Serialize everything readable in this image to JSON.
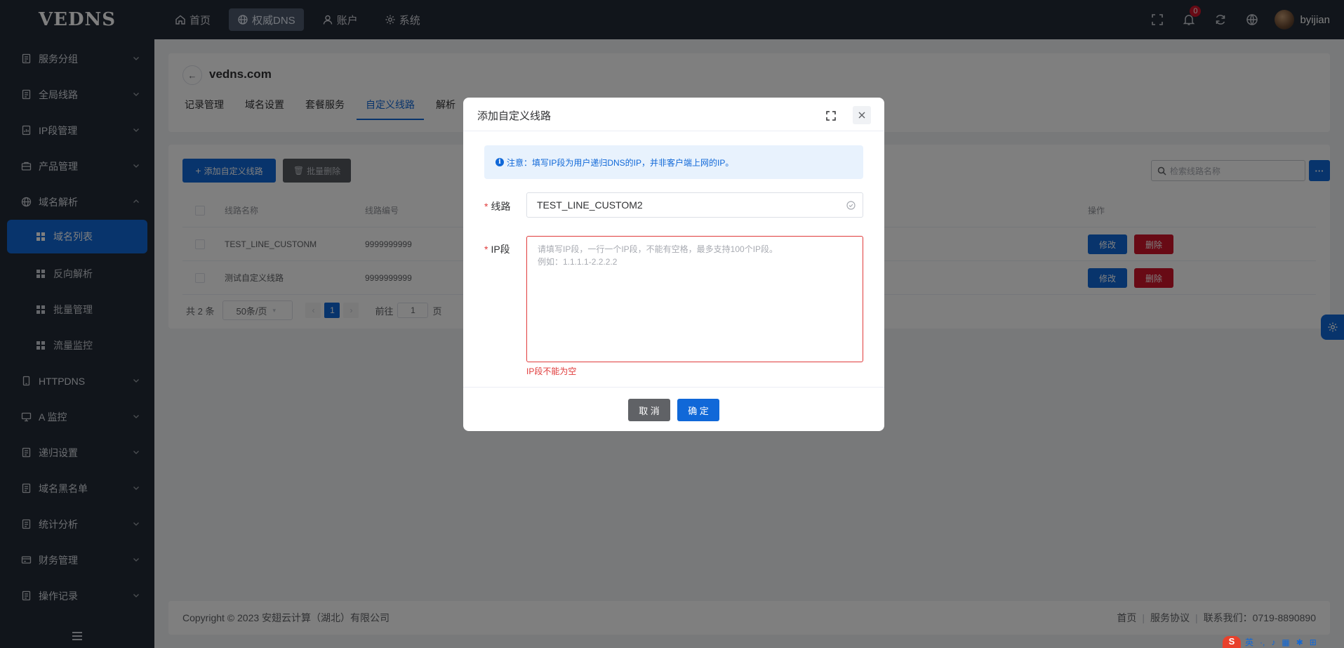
{
  "app": {
    "logo": "VEDNS"
  },
  "topnav": [
    {
      "label": "首页",
      "icon": "home-icon"
    },
    {
      "label": "权威DNS",
      "icon": "globe-icon"
    },
    {
      "label": "账户",
      "icon": "user-icon"
    },
    {
      "label": "系统",
      "icon": "gear-icon"
    }
  ],
  "topright": {
    "notification_count": "0",
    "username": "byijian"
  },
  "sidebar": {
    "items": [
      {
        "label": "服务分组"
      },
      {
        "label": "全局线路"
      },
      {
        "label": "IP段管理"
      },
      {
        "label": "产品管理"
      },
      {
        "label": "域名解析"
      },
      {
        "label": "HTTPDNS"
      },
      {
        "label": "A 监控"
      },
      {
        "label": "递归设置"
      },
      {
        "label": "域名黑名单"
      },
      {
        "label": "统计分析"
      },
      {
        "label": "财务管理"
      },
      {
        "label": "操作记录"
      }
    ],
    "sub_items": [
      {
        "label": "域名列表"
      },
      {
        "label": "反向解析"
      },
      {
        "label": "批量管理"
      },
      {
        "label": "流量监控"
      }
    ]
  },
  "header": {
    "domain": "vedns.com",
    "tabs": [
      "记录管理",
      "域名设置",
      "套餐服务",
      "自定义线路",
      "解析"
    ]
  },
  "toolbar": {
    "add_label": "添加自定义线路",
    "bulk_delete_label": "批量删除",
    "search_placeholder": "检索线路名称",
    "more_label": "···"
  },
  "table": {
    "headers": {
      "name": "线路名称",
      "code": "线路编号",
      "ops": "操作"
    },
    "rows": [
      {
        "name": "TEST_LINE_CUSTONM",
        "code": "9999999999",
        "edit": "修改",
        "delete": "删除"
      },
      {
        "name": "测试自定义线路",
        "code": "9999999999",
        "edit": "修改",
        "delete": "删除"
      }
    ]
  },
  "pagination": {
    "total": "共 2 条",
    "page_size": "50条/页",
    "current_page": "1",
    "goto_prefix": "前往",
    "goto_value": "1",
    "goto_suffix": "页"
  },
  "footer": {
    "copyright": "Copyright © 2023 安翅云计算（湖北）有限公司",
    "links": [
      "首页",
      "服务协议",
      "联系我们：0719-8890890"
    ]
  },
  "dialog": {
    "title": "添加自定义线路",
    "notice": "注意：填写IP段为用户递归DNS的IP，并非客户端上网的IP。",
    "line_label": "线路",
    "line_value": "TEST_LINE_CUSTOM2",
    "ip_label": "IP段",
    "ip_placeholder_line1": "请填写IP段，一行一个IP段，不能有空格，最多支持100个IP段。",
    "ip_placeholder_line2": "例如：1.1.1.1-2.2.2.2",
    "ip_error": "IP段不能为空",
    "cancel_label": "取 消",
    "confirm_label": "确 定"
  },
  "ime": {
    "logo": "S",
    "items": [
      "英",
      "·,",
      "♪",
      "▦",
      "✱",
      "⊞"
    ]
  },
  "colors": {
    "primary": "#1068d8",
    "danger": "#d0142a",
    "sidebar_bg": "#232a36"
  }
}
